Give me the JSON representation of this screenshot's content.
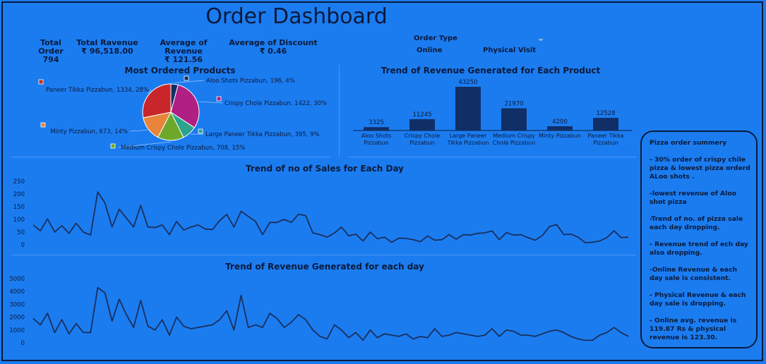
{
  "header": {
    "title": "Order Dashboard"
  },
  "kpis": [
    {
      "label": "Total Order",
      "value": "794"
    },
    {
      "label": "Total Ravenue",
      "value": "₹ 96,518.00"
    },
    {
      "label": "Average of Revenue",
      "value": "₹ 121.56"
    },
    {
      "label": "Average of Discount",
      "value": "₹ 0.46"
    }
  ],
  "slicer": {
    "title": "Order Type",
    "options": [
      "Online",
      "Physical Visit"
    ]
  },
  "colors": {
    "background": "#1b7cf0",
    "dark": "#0b1a3a",
    "bar": "#0f2f66",
    "line": "#1a2f5c"
  },
  "chart_data": [
    {
      "type": "pie",
      "title": "Most Ordered Products",
      "categories": [
        "Aloo Shots Pizzabun",
        "Crispy Chole Pizzabun",
        "Large Paneer Tikka Pizzabun",
        "Medium Crispy Chole Pizzabun",
        "Minty Pizzabun",
        "Paneer Tikka Pizzabun"
      ],
      "values": [
        196,
        1422,
        395,
        708,
        673,
        1334
      ],
      "labels": [
        "Aloo Shots Pizzabun, 196, 4%",
        "Crispy Chole Pizzabun, 1422, 30%",
        "Large Paneer Tikka Pizzabun, 395, 9%",
        "Medium Crispy Chole Pizzabun, 708, 15%",
        "Minty Pizzabun, 673, 14%",
        "Paneer Tikka Pizzabun, 1334, 28%"
      ],
      "colors": [
        "#0f2f66",
        "#b01f82",
        "#2aa48c",
        "#6ea82a",
        "#e8853a",
        "#c8262a"
      ]
    },
    {
      "type": "bar",
      "title": "Trend of Revenue Generated for Each Product",
      "categories": [
        "Aloo Shots Pizzabun",
        "Crispy Chole Pizzabun",
        "Large Paneer Tikka Pizzabun",
        "Medium Crispy Chole Pizzabun",
        "Minty Pizzabun",
        "Paneer Tikka Pizzabun"
      ],
      "values": [
        3325,
        11245,
        43250,
        21970,
        4200,
        12528
      ]
    },
    {
      "type": "line",
      "title": "Trend of no of Sales for Each Day",
      "ylim": [
        0,
        250
      ],
      "yticks": [
        0,
        50,
        100,
        150,
        200,
        250
      ],
      "values": [
        78,
        55,
        102,
        50,
        75,
        45,
        85,
        50,
        38,
        208,
        165,
        70,
        140,
        105,
        70,
        155,
        70,
        68,
        78,
        40,
        92,
        58,
        70,
        78,
        62,
        60,
        95,
        120,
        70,
        132,
        112,
        92,
        40,
        88,
        88,
        100,
        88,
        120,
        115,
        47,
        40,
        30,
        46,
        70,
        35,
        42,
        15,
        50,
        24,
        30,
        10,
        26,
        25,
        20,
        12,
        35,
        18,
        20,
        40,
        22,
        40,
        38,
        45,
        47,
        55,
        20,
        48,
        38,
        40,
        28,
        18,
        36,
        72,
        80,
        40,
        42,
        30,
        8,
        10,
        15,
        28,
        55,
        28,
        30
      ]
    },
    {
      "type": "line",
      "title": "Trend of Revenue Generated for each day",
      "ylim": [
        0,
        5000
      ],
      "yticks": [
        0,
        1000,
        2000,
        3000,
        4000,
        5000
      ],
      "values": [
        1900,
        1400,
        2300,
        800,
        1800,
        700,
        1500,
        800,
        800,
        4300,
        3900,
        1700,
        3400,
        2200,
        1200,
        3300,
        1300,
        1000,
        1800,
        600,
        2000,
        1300,
        1100,
        1200,
        1300,
        1400,
        1800,
        2500,
        1000,
        3700,
        1200,
        1400,
        1200,
        2300,
        1900,
        1200,
        1600,
        2200,
        1800,
        1000,
        500,
        300,
        1400,
        1000,
        400,
        800,
        200,
        1000,
        400,
        700,
        600,
        500,
        700,
        300,
        500,
        400,
        1100,
        500,
        600,
        800,
        700,
        600,
        500,
        600,
        1100,
        500,
        1000,
        900,
        600,
        600,
        500,
        700,
        900,
        1000,
        800,
        500,
        300,
        200,
        200,
        600,
        800,
        1200,
        800,
        500
      ]
    }
  ],
  "summary": {
    "title": "Pizza order summery",
    "items": [
      "- 30% order of crispy chile pizza & lowest  pizza orderd ALoo shots .",
      "-lowest revenue of Aloo shot pizza",
      "-Trend of no. of pizza sale each day dropping.",
      "-  Revenue trend of ech day also dropping.",
      "-Online Revenue & each day sale is consistent.",
      "-  Physical  Revenue & each day sale is dropping.",
      "- Online avg. revenue is 119.87 Rs & physical revenue is 123.30."
    ]
  }
}
